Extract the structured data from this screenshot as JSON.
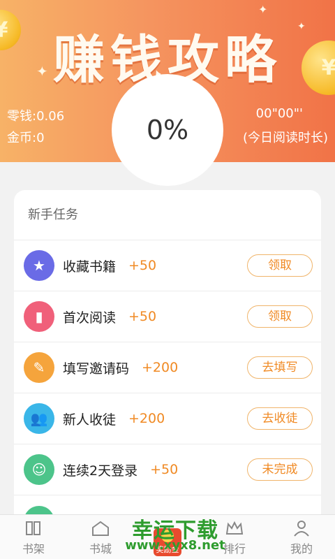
{
  "header": {
    "banner_title": "赚钱攻略",
    "change_label": "零钱:0.06",
    "gold_label": "金币:0",
    "reading_time": "00\"00\"'",
    "reading_time_label": "(今日阅读时长)",
    "progress_text": "0%"
  },
  "tasks": {
    "title": "新手任务",
    "items": [
      {
        "name": "收藏书籍",
        "reward": "+50",
        "button": "领取",
        "icon": "star-icon",
        "color": "#6a6be6"
      },
      {
        "name": "首次阅读",
        "reward": "+50",
        "button": "领取",
        "icon": "book-icon",
        "color": "#f0607a"
      },
      {
        "name": "填写邀请码",
        "reward": "+200",
        "button": "去填写",
        "icon": "edit-icon",
        "color": "#f5a43c"
      },
      {
        "name": "新人收徒",
        "reward": "+200",
        "button": "去收徒",
        "icon": "people-icon",
        "color": "#3ab6e8"
      },
      {
        "name": "连续2天登录",
        "reward": "+50",
        "button": "未完成",
        "icon": "user-check-icon",
        "color": "#4cc48a"
      }
    ]
  },
  "tabbar": {
    "items": [
      {
        "label": "书架",
        "icon": "bookshelf-icon"
      },
      {
        "label": "书城",
        "icon": "bookstore-icon"
      },
      {
        "label": "奖励金",
        "icon": "reward-icon"
      },
      {
        "label": "排行",
        "icon": "crown-icon"
      },
      {
        "label": "我的",
        "icon": "profile-icon"
      }
    ]
  },
  "watermark": {
    "title": "幸运下载",
    "url": "www.xyx8.net"
  },
  "colors": {
    "accent": "#f08a24",
    "header_start": "#f7b267",
    "header_end": "#f17347"
  }
}
